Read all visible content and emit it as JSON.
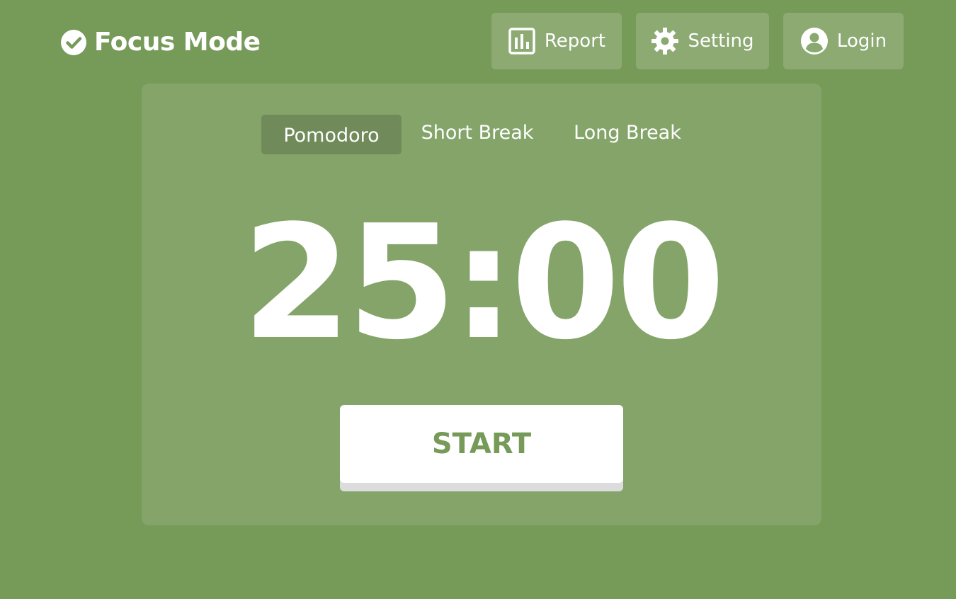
{
  "brand": {
    "title": "Focus Mode",
    "icon": "check-circle-icon"
  },
  "nav": {
    "report_label": "Report",
    "report_icon": "bar-chart-icon",
    "setting_label": "Setting",
    "setting_icon": "gear-icon",
    "login_label": "Login",
    "login_icon": "user-circle-icon"
  },
  "tabs": [
    {
      "label": "Pomodoro",
      "active": true
    },
    {
      "label": "Short Break",
      "active": false
    },
    {
      "label": "Long Break",
      "active": false
    }
  ],
  "timer": {
    "display": "25:00"
  },
  "actions": {
    "start_label": "START"
  },
  "colors": {
    "background": "#769a58",
    "accent": "#769a58",
    "text": "#ffffff"
  }
}
